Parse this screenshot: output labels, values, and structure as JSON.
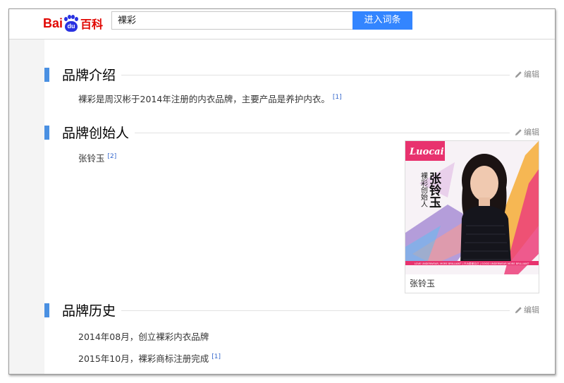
{
  "header": {
    "logo_bai": "Bai",
    "logo_du": "du",
    "logo_baike": "百科",
    "search_value": "裸彩",
    "search_button": "进入词条"
  },
  "edit_label": "编辑",
  "sections": [
    {
      "title": "品牌介绍",
      "paragraphs": [
        {
          "text": "裸彩是周汉彬于2014年注册的内衣品牌，主要产品是养护内衣。",
          "ref": "[1]"
        }
      ]
    },
    {
      "title": "品牌创始人",
      "paragraphs": [
        {
          "text": "张铃玉",
          "ref": "[2]"
        }
      ],
      "figure": {
        "caption": "张铃玉",
        "brand_logo_text": "Luocai",
        "vertical_text": "裸彩创始人",
        "signature": "张铃玉",
        "strip_text": "LOVE UNDERWEAR, MORE BRILLIANT | 只为更爱自己 | GOOD UNDERWEAR MORE BRILLIANT"
      }
    },
    {
      "title": "品牌历史",
      "paragraphs": [
        {
          "text": "2014年08月，创立裸彩内衣品牌",
          "ref": ""
        },
        {
          "text": "2015年10月，裸彩商标注册完成",
          "ref": "[1]"
        }
      ]
    }
  ],
  "colors": {
    "accent_blue": "#3385ff",
    "section_bar": "#4a90e2",
    "logo_red": "#e10601",
    "logo_blue": "#2932e1",
    "link_blue": "#3366cc"
  }
}
